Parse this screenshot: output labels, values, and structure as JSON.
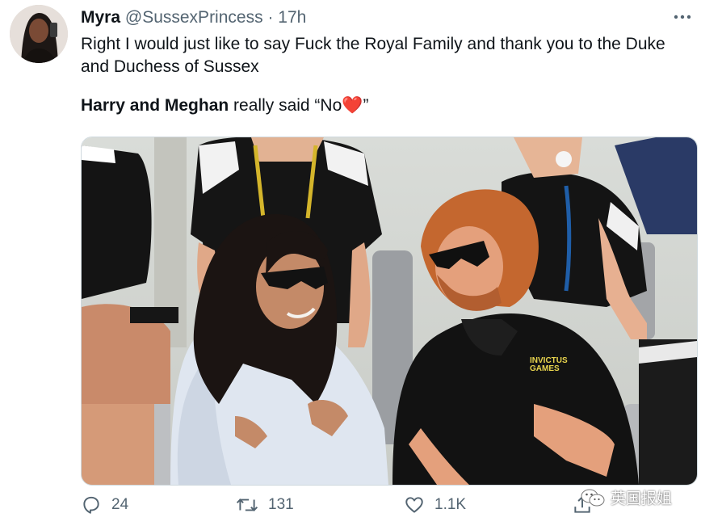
{
  "tweet": {
    "display_name": "Myra",
    "handle": "@SussexPrincess",
    "separator": "·",
    "timestamp": "17h",
    "text_line_1": "Right I would just like to say Fuck the Royal Family and thank you to the Duke and Duchess of Sussex",
    "bold_part": "Harry and Meghan",
    "text_part_2": " really said “No",
    "heart_emoji": "❤️",
    "text_part_3": "”"
  },
  "media": {
    "shirt_text": "INVICTUS GAMES"
  },
  "actions": {
    "reply_count": "24",
    "retweet_count": "131",
    "like_count": "1.1K"
  },
  "watermark": {
    "text": "英国报姐"
  },
  "icons": {
    "more": "more-horizontal-icon",
    "reply": "reply-icon",
    "retweet": "retweet-icon",
    "like": "heart-icon",
    "share": "share-icon",
    "watermark": "wechat-icon"
  },
  "colors": {
    "text_primary": "#0f1419",
    "text_secondary": "#536471",
    "heart": "#e0245e"
  }
}
